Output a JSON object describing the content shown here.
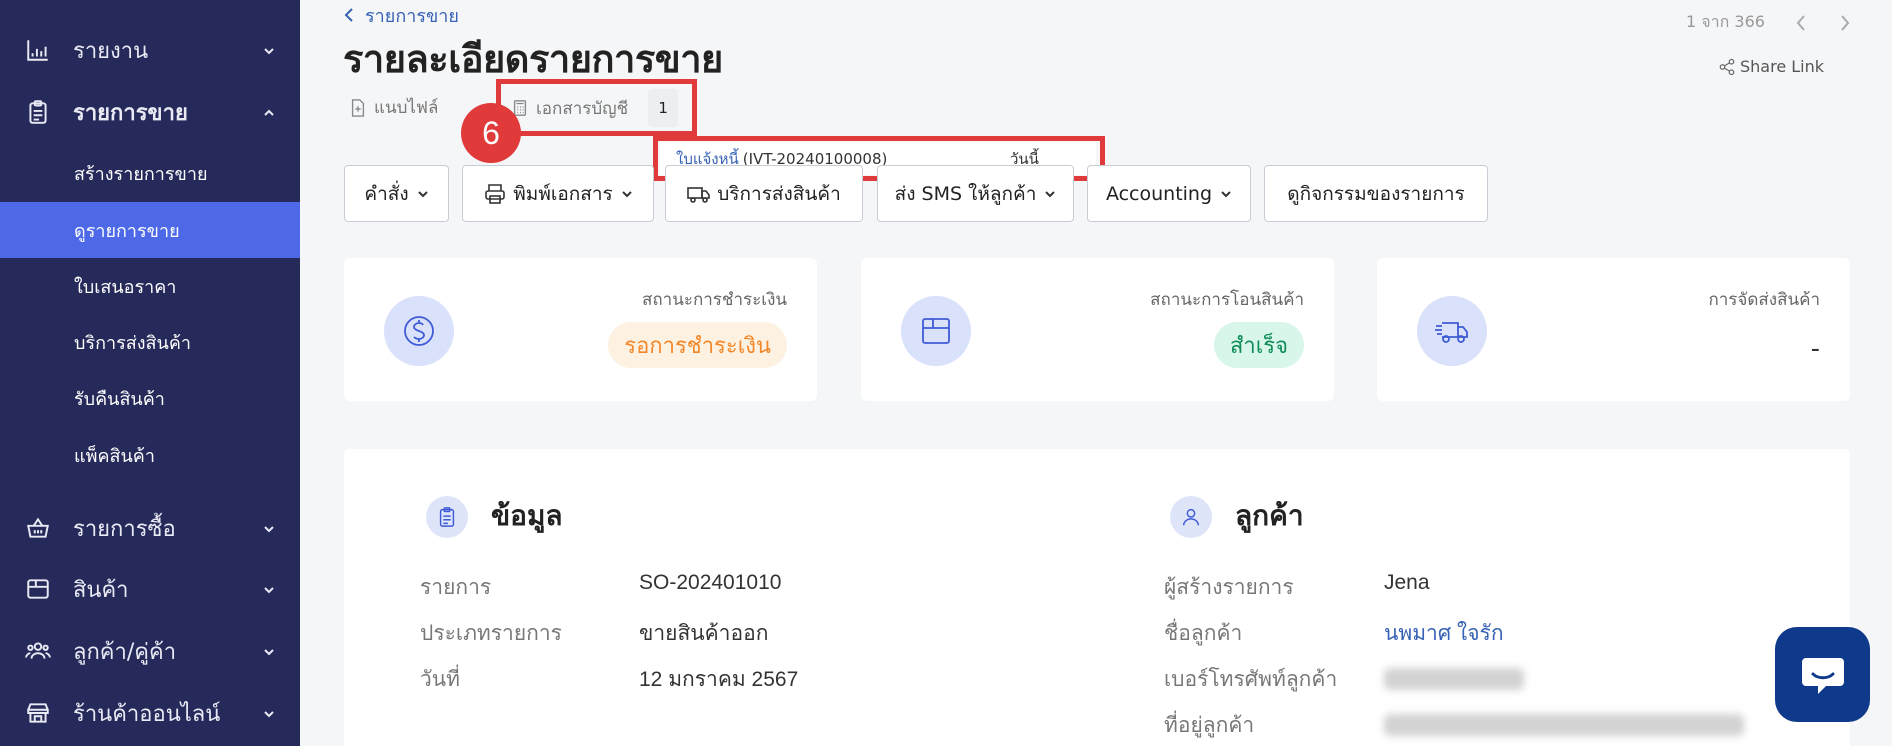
{
  "sidebar": {
    "items": [
      {
        "label": "รายงาน",
        "icon": "bar-chart-icon"
      },
      {
        "label": "รายการขาย",
        "icon": "clipboard-icon"
      },
      {
        "label": "รายการซื้อ",
        "icon": "basket-icon"
      },
      {
        "label": "สินค้า",
        "icon": "box-icon"
      },
      {
        "label": "ลูกค้า/คู่ค้า",
        "icon": "users-icon"
      },
      {
        "label": "ร้านค้าออนไลน์",
        "icon": "store-icon"
      }
    ],
    "sub_items": [
      {
        "label": "สร้างรายการขาย",
        "active": false
      },
      {
        "label": "ดูรายการขาย",
        "active": true
      },
      {
        "label": "ใบเสนอราคา",
        "active": false
      },
      {
        "label": "บริการส่งสินค้า",
        "active": false
      },
      {
        "label": "รับคืนสินค้า",
        "active": false
      },
      {
        "label": "แพ็คสินค้า",
        "active": false
      }
    ]
  },
  "header": {
    "breadcrumb": "รายการขาย",
    "title": "รายละเอียดรายการขาย",
    "pager_text": "1 จาก 366",
    "share_label": "Share Link"
  },
  "tabs": {
    "attach_label": "แนบไฟล์",
    "docs_label": "เอกสารบัญชี",
    "docs_count": "1"
  },
  "annotation": {
    "step": "6",
    "highlight_color": "#e03a3a"
  },
  "dropdown": {
    "doc_type": "ใบแจ้งหนี้",
    "doc_number": "(IVT-20240100008)",
    "doc_date": "วันนี้"
  },
  "actions": {
    "command": "คำสั่ง",
    "print": "พิมพ์เอกสาร",
    "shipping": "บริการส่งสินค้า",
    "sms": "ส่ง SMS ให้ลูกค้า",
    "accounting": "Accounting",
    "activity": "ดูกิจกรรมของรายการ"
  },
  "status_cards": {
    "payment": {
      "label": "สถานะการชำระเงิน",
      "value": "รอการชำระเงิน"
    },
    "transfer": {
      "label": "สถานะการโอนสินค้า",
      "value": "สำเร็จ"
    },
    "delivery": {
      "label": "การจัดส่งสินค้า",
      "value": "-"
    }
  },
  "info": {
    "title": "ข้อมูล",
    "fields": [
      {
        "label": "รายการ",
        "value": "SO-202401010"
      },
      {
        "label": "ประเภทรายการ",
        "value": "ขายสินค้าออก"
      },
      {
        "label": "วันที่",
        "value": "12 มกราคม 2567"
      }
    ]
  },
  "customer": {
    "title": "ลูกค้า",
    "fields": [
      {
        "label": "ผู้สร้างรายการ",
        "value": "Jena"
      },
      {
        "label": "ชื่อลูกค้า",
        "value": "นพมาศ ใจรัก"
      },
      {
        "label": "เบอร์โทรศัพท์ลูกค้า",
        "value": ""
      },
      {
        "label": "ที่อยู่ลูกค้า",
        "value": ""
      }
    ]
  },
  "colors": {
    "sidebar_bg": "#262a5a",
    "active_item": "#4e69e8",
    "link": "#3762b5",
    "chat_button": "#0f3a8c"
  }
}
